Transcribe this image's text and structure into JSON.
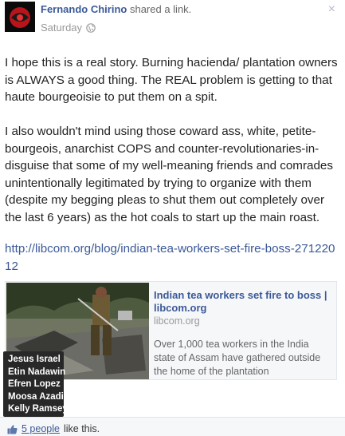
{
  "post": {
    "author": "Fernando Chirino",
    "action": "shared a link.",
    "timestamp": "Saturday",
    "privacy_icon": "globe-icon",
    "close_icon": "×",
    "paragraphs": [
      "I hope this is a real story. Burning hacienda/ plantation owners is ALWAYS a good thing. The REAL problem is getting to that haute bourgeoisie to put them on a spit.",
      "I also wouldn't mind using those coward ass, white, petite-bourgeois, anarchist COPS and counter-revolutionaries-in-disguise that some of my well-meaning friends and comrades unintentionally legitimated by trying to organize with them (despite my begging pleas to shut them out completely over the last 6 years) as the hot coals to start up the main roast."
    ],
    "link": "http://libcom.org/blog/indian-tea-workers-set-fire-boss-27122012"
  },
  "share": {
    "title": "Indian tea workers set fire to boss | libcom.org",
    "domain": "libcom.org",
    "description": "Over 1,000 tea workers in the India state of Assam have gathered outside the home of the plantation"
  },
  "likes": {
    "tooltip_names": [
      "Jesus Israel",
      "Etin Nadawin",
      "Efren Lopez",
      "Moosa Azadian",
      "Kelly Ramsey"
    ],
    "count_link": "5 people",
    "suffix": "like this.",
    "icon": "thumbs-up-icon"
  },
  "colors": {
    "link_blue": "#3b5998",
    "tooltip_bg": "#282828",
    "footer_bg": "#f6f7f9"
  }
}
